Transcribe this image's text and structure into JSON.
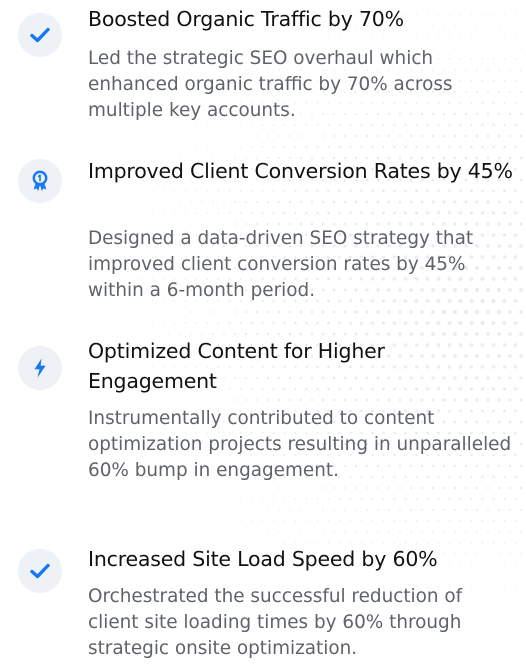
{
  "achievements": [
    {
      "icon": "check-icon",
      "title": "Boosted Organic Traffic by 70%",
      "description": "Led the strategic SEO overhaul which enhanced organic traffic by 70% across multiple key accounts."
    },
    {
      "icon": "award-ribbon-icon",
      "title": "Improved Client Conversion Rates by 45%",
      "description": "Designed a data-driven SEO strategy that improved client conversion rates by 45% within a 6-month period."
    },
    {
      "icon": "lightning-bolt-icon",
      "title": "Optimized Content for Higher Engagement",
      "description": "Instrumentally contributed to content optimization projects resulting in unparalleled 60% bump in engagement."
    },
    {
      "icon": "check-icon",
      "title": "Increased Site Load Speed by 60%",
      "description": "Orchestrated the successful reduction of client site loading times by 60% through strategic onsite optimization."
    }
  ],
  "colors": {
    "accent": "#1877f2",
    "icon_bg": "#eef1f6",
    "title": "#111111",
    "description": "#5f6368"
  }
}
